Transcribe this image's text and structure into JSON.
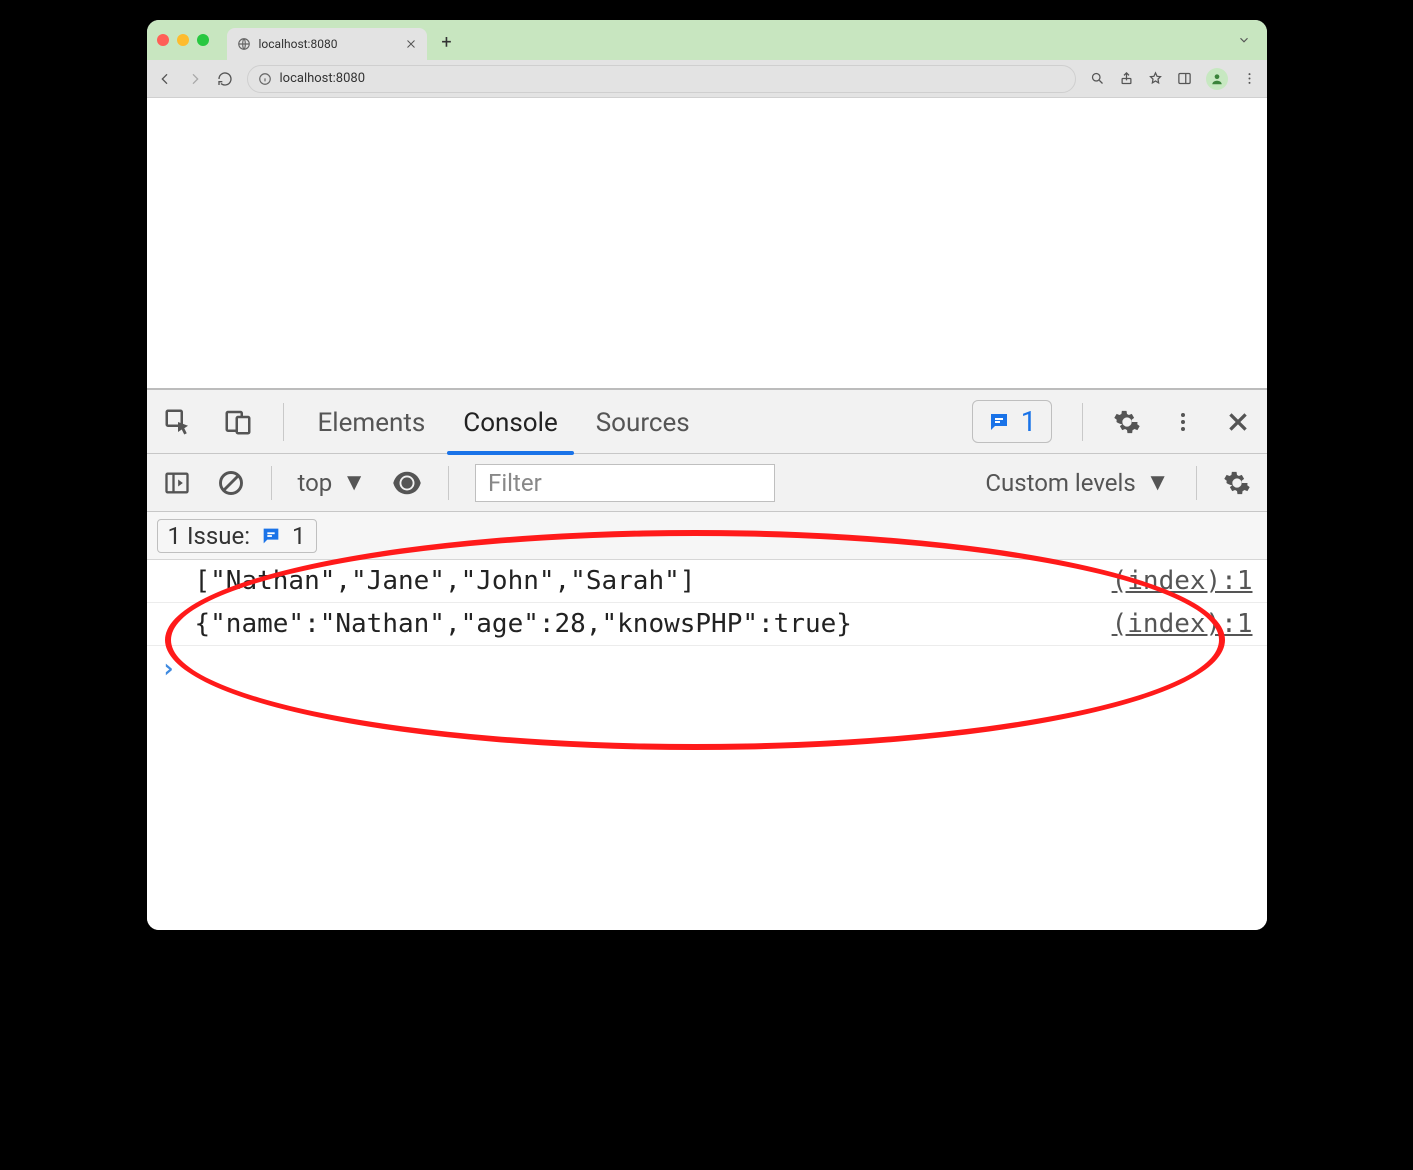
{
  "browser": {
    "tab_title": "localhost:8080",
    "url_display": "localhost:8080"
  },
  "devtools": {
    "tabs": {
      "elements": "Elements",
      "console": "Console",
      "sources": "Sources"
    },
    "issues_badge": "1",
    "toolbar": {
      "context": "top",
      "filter_placeholder": "Filter",
      "levels": "Custom levels"
    },
    "issues_row": {
      "label": "1 Issue:",
      "count": "1"
    },
    "log": [
      {
        "msg": "[\"Nathan\",\"Jane\",\"John\",\"Sarah\"]",
        "src": "(index):1"
      },
      {
        "msg": "{\"name\":\"Nathan\",\"age\":28,\"knowsPHP\":true}",
        "src": "(index):1"
      }
    ]
  }
}
